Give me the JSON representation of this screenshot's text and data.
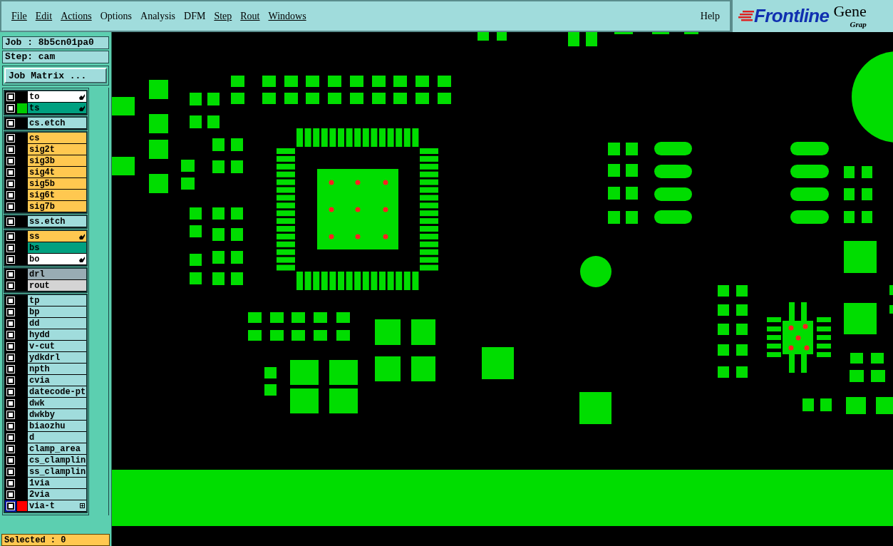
{
  "menu": [
    {
      "label": "File",
      "underlined": true
    },
    {
      "label": "Edit",
      "underlined": true
    },
    {
      "label": "Actions",
      "underlined": true
    },
    {
      "label": "Options",
      "underlined": false
    },
    {
      "label": "Analysis",
      "underlined": false
    },
    {
      "label": "DFM",
      "underlined": false
    },
    {
      "label": "Step",
      "underlined": true
    },
    {
      "label": "Rout",
      "underlined": true
    },
    {
      "label": "Windows",
      "underlined": true
    }
  ],
  "help": "Help",
  "logo": {
    "brand": "Frontline",
    "product": "Gene",
    "subtitle": "Grap"
  },
  "job": "Job : 8b5cn01pa0",
  "step": "Step: cam",
  "job_matrix_button": "Job Matrix ...",
  "layer_groups": [
    [
      {
        "name": "to",
        "color": "#ffffff",
        "checked": false,
        "pointer": true,
        "focused": false
      },
      {
        "name": "ts",
        "color": "#00a080",
        "checked": false,
        "pointer": true,
        "focused": false,
        "display": {
          "color": "#00cc00"
        }
      }
    ],
    [
      {
        "name": "cs.etch",
        "color": "#a0dcdc",
        "checked": false,
        "pointer": false,
        "focused": false
      }
    ],
    [
      {
        "name": "cs",
        "color": "#ffc850",
        "checked": false,
        "pointer": false,
        "focused": false
      },
      {
        "name": "sig2t",
        "color": "#ffc850",
        "checked": false,
        "pointer": false,
        "focused": false
      },
      {
        "name": "sig3b",
        "color": "#ffc850",
        "checked": false,
        "pointer": false,
        "focused": false
      },
      {
        "name": "sig4t",
        "color": "#ffc850",
        "checked": false,
        "pointer": false,
        "focused": false
      },
      {
        "name": "sig5b",
        "color": "#ffc850",
        "checked": false,
        "pointer": false,
        "focused": false
      },
      {
        "name": "sig6t",
        "color": "#ffc850",
        "checked": false,
        "pointer": false,
        "focused": false
      },
      {
        "name": "sig7b",
        "color": "#ffc850",
        "checked": false,
        "pointer": false,
        "focused": false
      }
    ],
    [
      {
        "name": "ss.etch",
        "color": "#a0dcdc",
        "checked": false,
        "pointer": false,
        "focused": false
      }
    ],
    [
      {
        "name": "ss",
        "color": "#ffc850",
        "checked": false,
        "pointer": true,
        "focused": false
      },
      {
        "name": "bs",
        "color": "#00a080",
        "checked": false,
        "pointer": false,
        "focused": false
      },
      {
        "name": "bo",
        "color": "#ffffff",
        "checked": false,
        "pointer": true,
        "focused": false
      }
    ],
    [
      {
        "name": "drl",
        "color": "#98acb4",
        "checked": false,
        "pointer": false,
        "focused": false
      },
      {
        "name": "rout",
        "color": "#d4d4d4",
        "checked": false,
        "pointer": false,
        "focused": false
      }
    ],
    [
      {
        "name": "tp",
        "color": "#a0dcdc",
        "checked": false,
        "pointer": false,
        "focused": false
      },
      {
        "name": "bp",
        "color": "#a0dcdc",
        "checked": false,
        "pointer": false,
        "focused": false
      },
      {
        "name": "dd",
        "color": "#a0dcdc",
        "checked": false,
        "pointer": false,
        "focused": false
      },
      {
        "name": "hydd",
        "color": "#a0dcdc",
        "checked": false,
        "pointer": false,
        "focused": false
      },
      {
        "name": "v-cut",
        "color": "#a0dcdc",
        "checked": false,
        "pointer": false,
        "focused": false
      },
      {
        "name": "ydkdrl",
        "color": "#a0dcdc",
        "checked": false,
        "pointer": false,
        "focused": false
      },
      {
        "name": "npth",
        "color": "#a0dcdc",
        "checked": false,
        "pointer": false,
        "focused": false
      },
      {
        "name": "cvia",
        "color": "#a0dcdc",
        "checked": false,
        "pointer": false,
        "focused": false
      },
      {
        "name": "datecode-pt",
        "color": "#a0dcdc",
        "checked": false,
        "pointer": false,
        "focused": false
      },
      {
        "name": "dwk",
        "color": "#a0dcdc",
        "checked": false,
        "pointer": false,
        "focused": false
      },
      {
        "name": "dwkby",
        "color": "#a0dcdc",
        "checked": false,
        "pointer": false,
        "focused": false
      },
      {
        "name": "biaozhu",
        "color": "#a0dcdc",
        "checked": false,
        "pointer": false,
        "focused": false
      },
      {
        "name": "d",
        "color": "#a0dcdc",
        "checked": false,
        "pointer": false,
        "focused": false
      },
      {
        "name": "clamp_area",
        "color": "#a0dcdc",
        "checked": false,
        "pointer": false,
        "focused": false
      },
      {
        "name": "cs_clamplin",
        "color": "#a0dcdc",
        "checked": false,
        "pointer": false,
        "focused": false
      },
      {
        "name": "ss_clamplin",
        "color": "#a0dcdc",
        "checked": false,
        "pointer": false,
        "focused": false
      },
      {
        "name": "1via",
        "color": "#a0dcdc",
        "checked": false,
        "pointer": false,
        "focused": false
      },
      {
        "name": "2via",
        "color": "#a0dcdc",
        "checked": false,
        "pointer": false,
        "focused": false
      },
      {
        "name": "via-t",
        "color": "#a0dcdc",
        "checked": false,
        "pointer": false,
        "focused": true,
        "display": {
          "color": "#ff0000"
        },
        "expandable": true
      }
    ]
  ],
  "status": "Selected : 0"
}
